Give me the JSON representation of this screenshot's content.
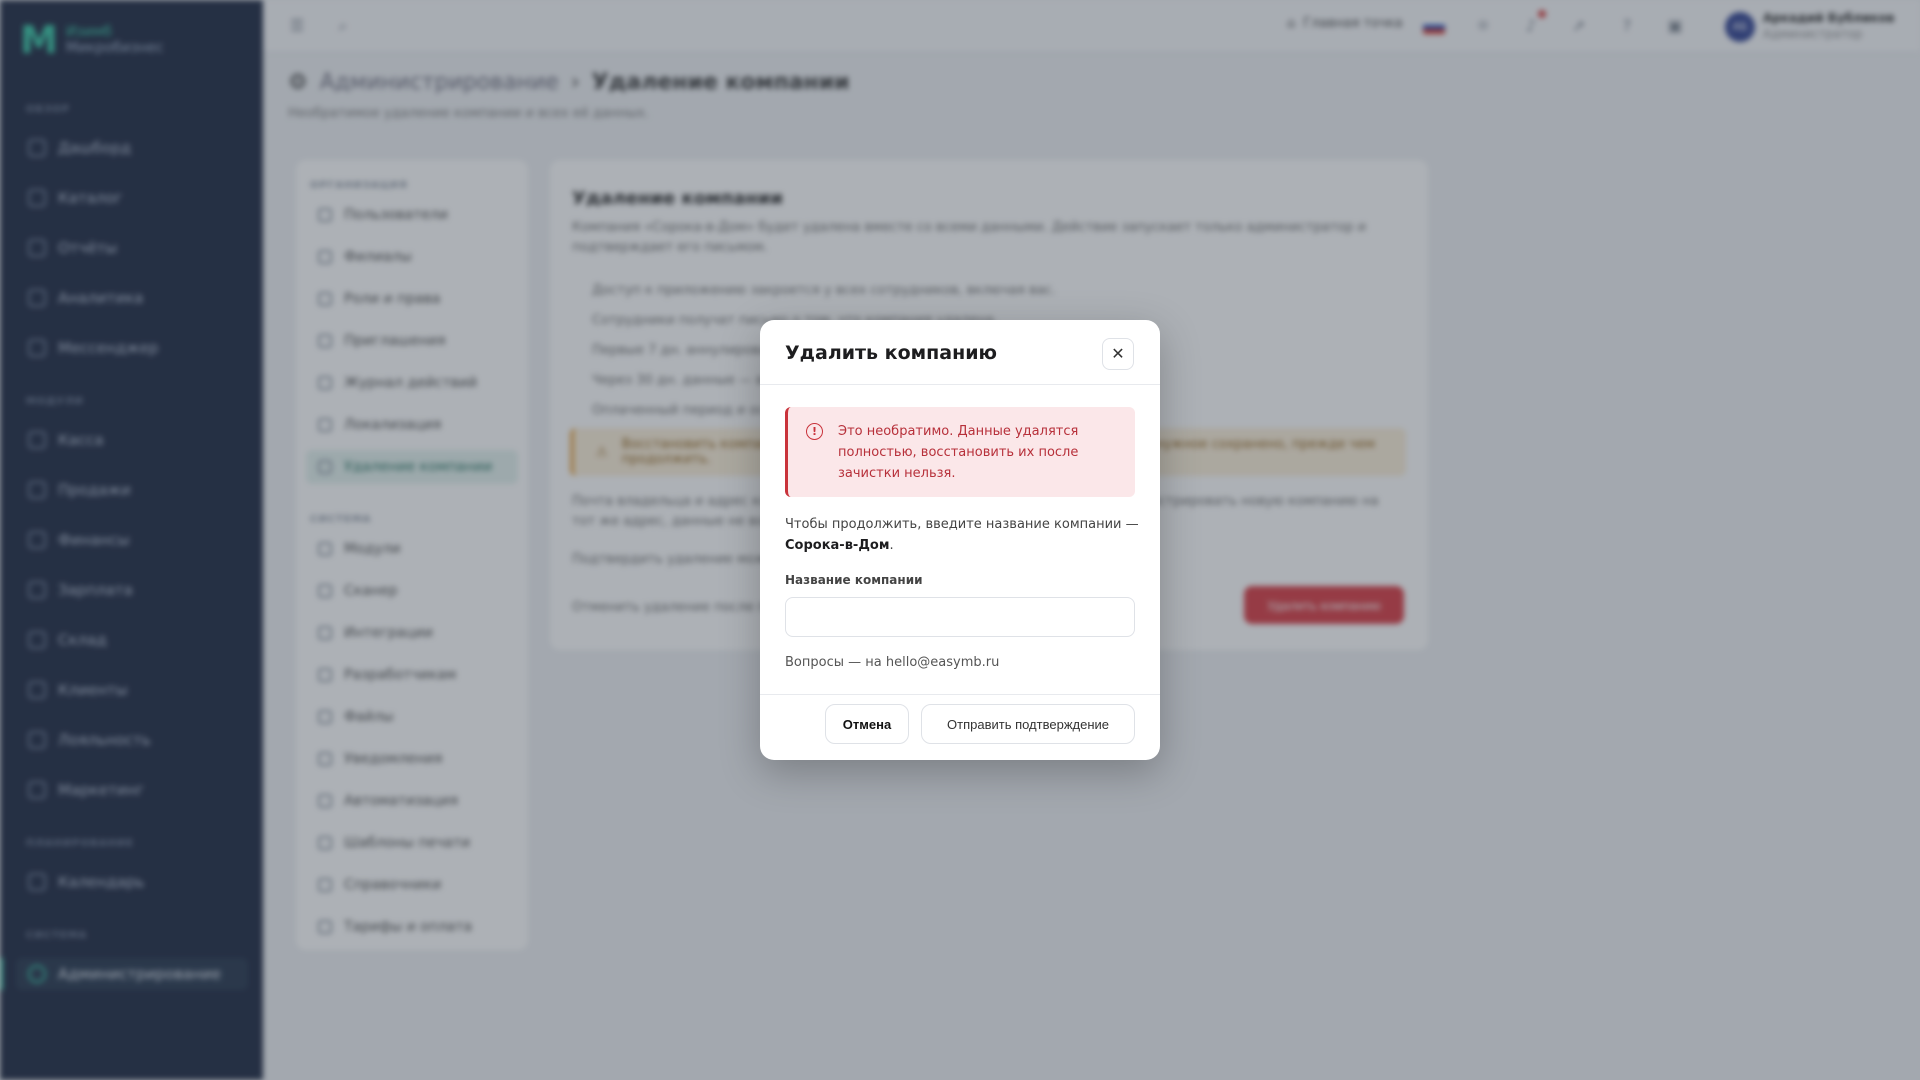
{
  "brand": {
    "line1": "Изимб",
    "line2": "Микробизнес"
  },
  "sidebar": {
    "sections": [
      "ОБЗОР",
      "МОДУЛИ",
      "ПЛАНИРОВАНИЕ",
      "СИСТЕМА"
    ],
    "items": [
      {
        "label": "Дашборд"
      },
      {
        "label": "Каталог"
      },
      {
        "label": "Отчёты"
      },
      {
        "label": "Аналитика"
      },
      {
        "label": "Мессенджер"
      },
      {
        "label": "Касса"
      },
      {
        "label": "Продажи"
      },
      {
        "label": "Финансы"
      },
      {
        "label": "Зарплата"
      },
      {
        "label": "Склад"
      },
      {
        "label": "Клиенты"
      },
      {
        "label": "Лояльность"
      },
      {
        "label": "Маркетинг"
      },
      {
        "label": "Календарь"
      },
      {
        "label": "Администрирование"
      }
    ]
  },
  "topbar": {
    "main_point": "Главная точка",
    "notif_count": "",
    "user": {
      "name": "Аркадий Бубликов",
      "role": "Администратор",
      "initials": "АБ"
    }
  },
  "page": {
    "crumb_root": "Администрирование",
    "crumb_current": "Удаление компании",
    "subtitle": "Необратимое удаление компании и всех её данных."
  },
  "admin_nav": {
    "section_org": "ОРГАНИЗАЦИЯ",
    "section_sys": "СИСТЕМА",
    "org_items": [
      "Пользователи",
      "Филиалы",
      "Роли и права",
      "Приглашения",
      "Журнал действий",
      "Локализация",
      "Удаление компании"
    ],
    "sys_items": [
      "Модули",
      "Сканер",
      "Интеграции",
      "Разработчикам",
      "Файлы",
      "Уведомления",
      "Автоматизация",
      "Шаблоны печати",
      "Справочники",
      "Тарифы и оплата"
    ]
  },
  "card": {
    "title": "Удаление компании",
    "desc": "Компания «Сорока-в-Дом» будет удалена вместе со всеми данными. Действие запускает только администратор и подтверждает его письмом.",
    "bullets": [
      "Доступ к приложению закроется у всех сотрудников, включая вас.",
      "Сотрудники получат письмо о том, что компания удалена.",
      "Первые 7 дн. аннулирование возможно.",
      "Через 30 дн. данные — в архиве.",
      "Оплаченный период и остаток не возвращаются."
    ],
    "warning": "Восстановить компанию после удаления будет нельзя — убедитесь, что всё нужное сохранено, прежде чем продолжить.",
    "p1": "Почта владельца и адрес компании освободятся — при желании вы сможете зарегистрировать новую компанию на тот же адрес, данные не войдут.",
    "p2": "Подтвердить удаление может только владелец компании.",
    "p3": "Отменить удаление после подтверждения нельзя.",
    "danger_button": "Удалить компанию"
  },
  "modal": {
    "title": "Удалить компанию",
    "alert": "Это необратимо. Данные удалятся полностью, восстановить их после зачистки нельзя.",
    "prompt_prefix": "Чтобы продолжить, введите название компании —",
    "company_name": "Сорока-в-Дом",
    "prompt_suffix": ".",
    "field_label": "Название компании",
    "field_value": "",
    "questions": "Вопросы — на hello@easymb.ru",
    "cancel": "Отмена",
    "submit": "Отправить подтверждение"
  },
  "colors": {
    "accent": "#31c7a4",
    "danger": "#d7353d",
    "sidebar_bg": "#16213b"
  }
}
